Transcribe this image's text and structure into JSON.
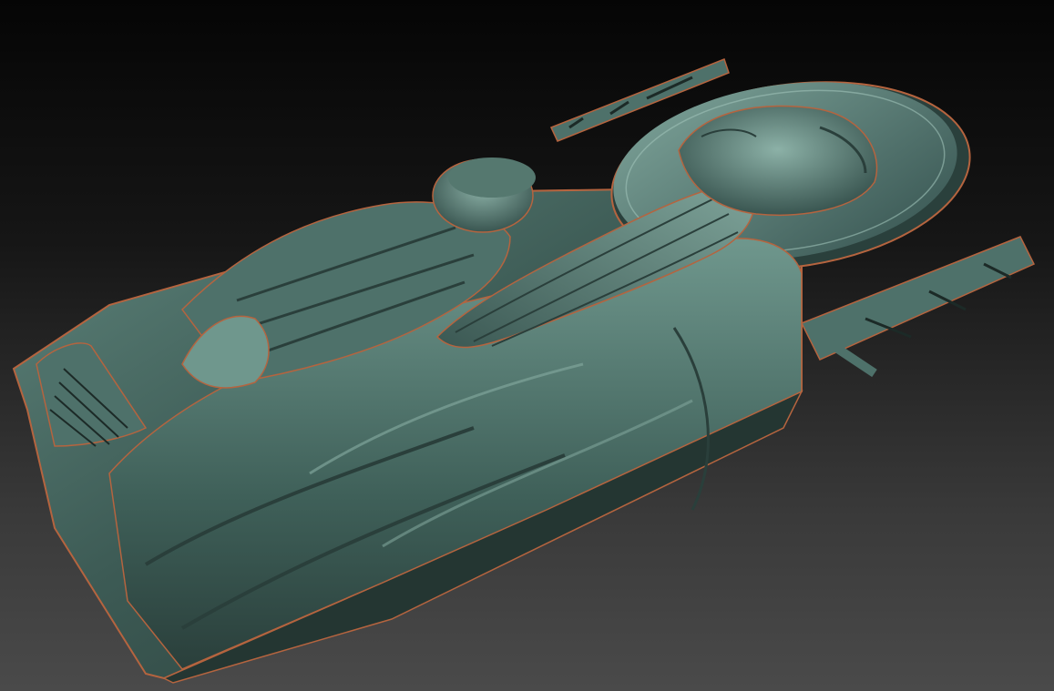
{
  "scene": {
    "background_top": "#050505",
    "background_bottom": "#4a4a4a",
    "material_base": "#3f5e58",
    "material_highlight": "#8fb3a9",
    "material_shadow": "#1c2a27",
    "material_rim": "#b5643f"
  },
  "icons": [
    "scroll",
    "halo",
    "lettering"
  ]
}
